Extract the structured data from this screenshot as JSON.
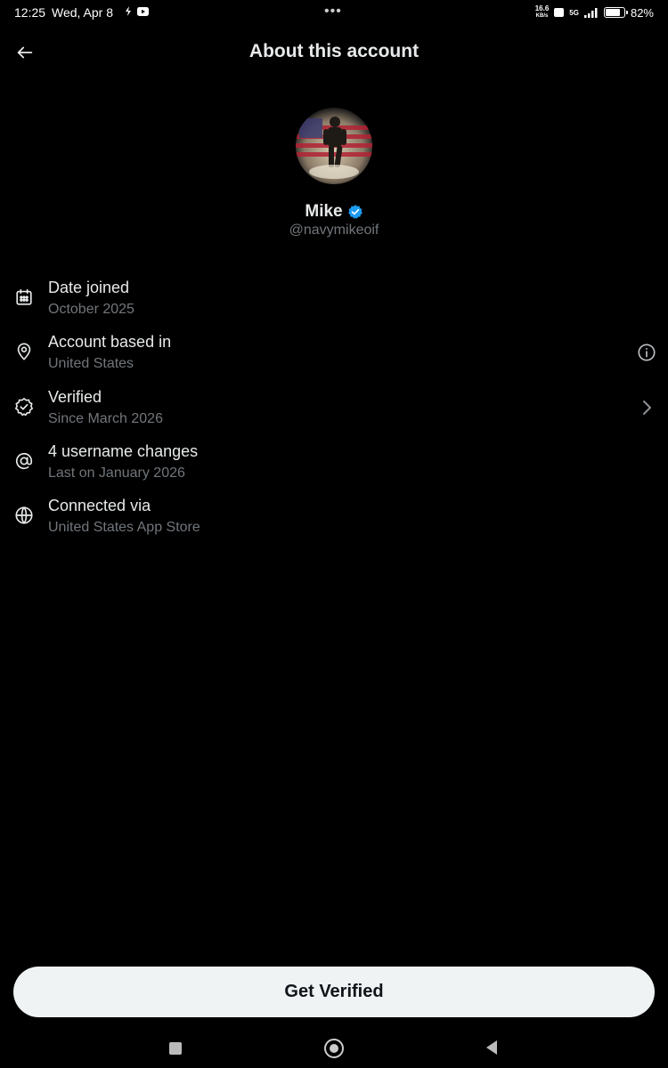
{
  "status_bar": {
    "time": "12:25",
    "date": "Wed, Apr 8",
    "dots": "•••",
    "net_speed": "16.6",
    "net_unit": "KB/s",
    "signal": "5G",
    "battery_level": 0.82,
    "battery_percent": "82%"
  },
  "header": {
    "title": "About this account",
    "back_icon": "arrow-left-icon"
  },
  "profile": {
    "name": "Mike",
    "handle": "@navymikeoif",
    "verified_color": "#1d9bf0"
  },
  "info_rows": [
    {
      "icon": "calendar-icon",
      "title": "Date joined",
      "subtitle": "October 2025",
      "trailing": null
    },
    {
      "icon": "location-pin-icon",
      "title": "Account based in",
      "subtitle": "United States",
      "trailing": "info-icon"
    },
    {
      "icon": "verified-check-icon",
      "title": "Verified",
      "subtitle": "Since March 2026",
      "trailing": "chevron-right-icon"
    },
    {
      "icon": "at-sign-icon",
      "title": "4 username changes",
      "subtitle": "Last on January 2026",
      "trailing": null
    },
    {
      "icon": "globe-icon",
      "title": "Connected via",
      "subtitle": "United States App Store",
      "trailing": null
    }
  ],
  "cta": {
    "label": "Get Verified"
  },
  "colors": {
    "background": "#000000",
    "primary_text": "#e7e9ea",
    "secondary_text": "#71767b",
    "button_bg": "#eff3f4"
  }
}
